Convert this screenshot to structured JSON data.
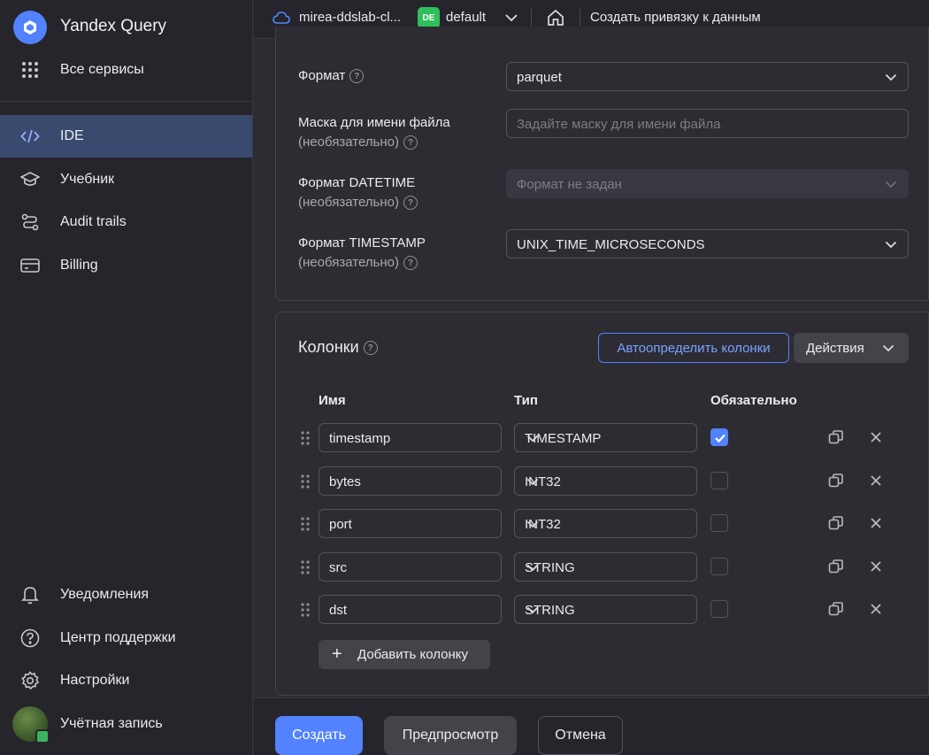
{
  "sidebar": {
    "brand": "Yandex Query",
    "all_services": "Все сервисы",
    "nav": [
      {
        "label": "IDE",
        "icon": "code-icon",
        "active": true
      },
      {
        "label": "Учебник",
        "icon": "graduation-cap-icon",
        "active": false
      },
      {
        "label": "Audit trails",
        "icon": "route-icon",
        "active": false
      },
      {
        "label": "Billing",
        "icon": "credit-card-icon",
        "active": false
      }
    ],
    "bottom": [
      {
        "label": "Уведомления",
        "icon": "bell-icon"
      },
      {
        "label": "Центр поддержки",
        "icon": "question-circle-icon"
      },
      {
        "label": "Настройки",
        "icon": "gear-icon"
      },
      {
        "label": "Учётная запись",
        "icon": "avatar"
      }
    ]
  },
  "header": {
    "folder": "mirea-ddslab-cl...",
    "badge": "DE",
    "environment": "default",
    "page_title": "Создать привязку к данным"
  },
  "format_section": {
    "format_label": "Формат",
    "format_value": "parquet",
    "mask_label": "Маска для имени файла",
    "mask_sub": "(необязательно)",
    "mask_placeholder": "Задайте маску для имени файла",
    "datetime_label": "Формат DATETIME",
    "datetime_sub": "(необязательно)",
    "datetime_placeholder": "Формат не задан",
    "timestamp_label": "Формат TIMESTAMP",
    "timestamp_sub": "(необязательно)",
    "timestamp_value": "UNIX_TIME_MICROSECONDS"
  },
  "columns": {
    "title": "Колонки",
    "auto_detect": "Автоопределить колонки",
    "actions": "Действия",
    "headers": {
      "name": "Имя",
      "type": "Тип",
      "required": "Обязательно"
    },
    "rows": [
      {
        "name": "timestamp",
        "type": "TIMESTAMP",
        "required": true
      },
      {
        "name": "bytes",
        "type": "INT32",
        "required": false
      },
      {
        "name": "port",
        "type": "INT32",
        "required": false
      },
      {
        "name": "src",
        "type": "STRING",
        "required": false
      },
      {
        "name": "dst",
        "type": "STRING",
        "required": false
      }
    ],
    "add_column": "Добавить колонку"
  },
  "footer": {
    "create": "Создать",
    "preview": "Предпросмотр",
    "cancel": "Отмена"
  },
  "colors": {
    "accent": "#5282ff",
    "badge_green": "#2fbf5c",
    "background": "#2d2c33",
    "sidebar": "#26252b"
  }
}
